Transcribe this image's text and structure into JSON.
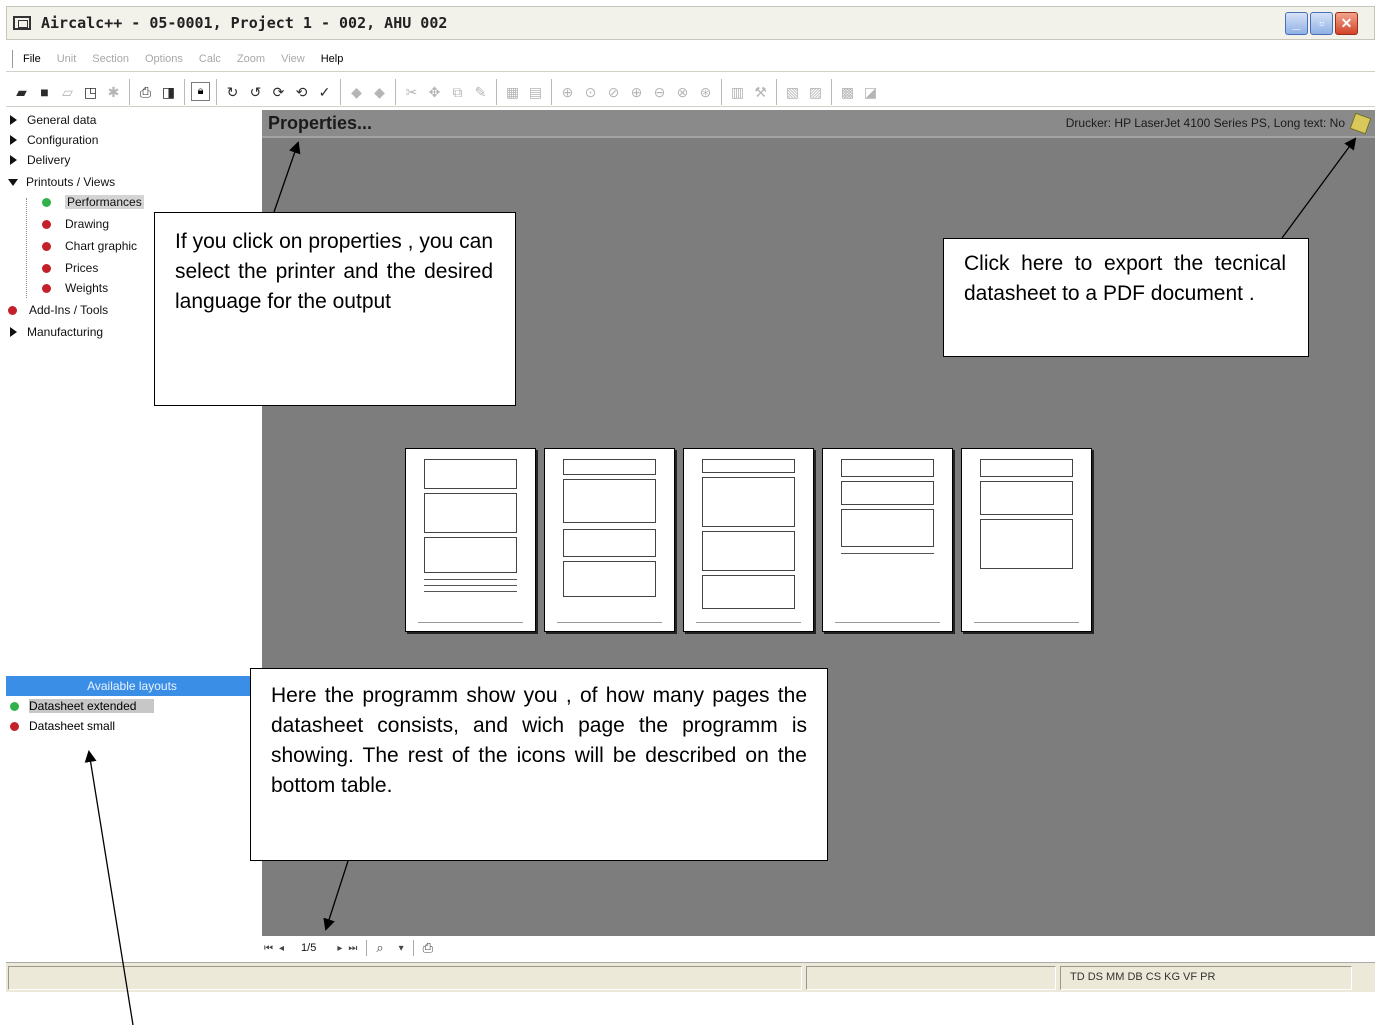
{
  "window": {
    "title": "Aircalc++  - 05-0001,  Project 1   - 002,  AHU 002"
  },
  "menu": [
    {
      "label": "File",
      "enabled": true
    },
    {
      "label": "Unit",
      "enabled": false
    },
    {
      "label": "Section",
      "enabled": false
    },
    {
      "label": "Options",
      "enabled": false
    },
    {
      "label": "Calc",
      "enabled": false
    },
    {
      "label": "Zoom",
      "enabled": false
    },
    {
      "label": "View",
      "enabled": false
    },
    {
      "label": "Help",
      "enabled": true
    }
  ],
  "tree": {
    "items": [
      {
        "label": "General data",
        "type": "collapsed"
      },
      {
        "label": "Configuration",
        "type": "collapsed"
      },
      {
        "label": "Delivery",
        "type": "collapsed"
      },
      {
        "label": "Printouts / Views",
        "type": "expanded"
      },
      {
        "label": "Performances",
        "type": "child-green"
      },
      {
        "label": "Drawing",
        "type": "child-red"
      },
      {
        "label": "Chart graphic",
        "type": "child-red"
      },
      {
        "label": "Prices",
        "type": "child-red"
      },
      {
        "label": "Weights",
        "type": "child-red"
      },
      {
        "label": "Add-Ins / Tools",
        "type": "red"
      },
      {
        "label": "Manufacturing",
        "type": "collapsed"
      }
    ]
  },
  "layouts": {
    "header": "Available layouts",
    "items": [
      {
        "label": "Datasheet extended",
        "status": "green"
      },
      {
        "label": "Datasheet small",
        "status": "red"
      }
    ]
  },
  "properties": {
    "title": "Properties...",
    "printer_info": "Drucker: HP LaserJet 4100 Series PS,  Long text: No"
  },
  "navigation": {
    "page_count": "1/5"
  },
  "status": {
    "indicators": "TD DS MM DB CS KG VF PR"
  },
  "callouts": {
    "properties": "If you click on properties , you can select the printer and the desired language for the output",
    "export": "Click here to export the tecnical datasheet to a PDF document .",
    "pages": "Here the programm show you , of how many pages the datasheet consists, and wich page the programm is showing. The rest of the icons will be described on the bottom table."
  },
  "colors": {
    "preview_background": "#7d7d7d",
    "layouts_header": "#3b8ee6",
    "status_ok": "#32b14a",
    "status_missing": "#c4202a"
  }
}
